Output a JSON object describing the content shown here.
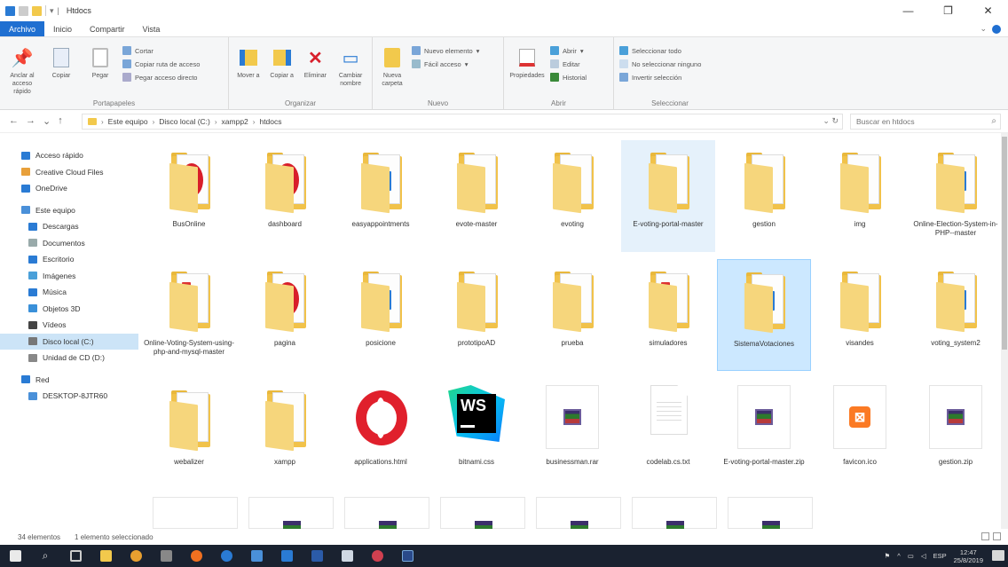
{
  "window": {
    "title": "Htdocs",
    "minimize": "—",
    "maximize": "❐",
    "close": "✕"
  },
  "ribbon_tabs": [
    "Archivo",
    "Inicio",
    "Compartir",
    "Vista"
  ],
  "ribbon": {
    "portapapeles": {
      "label": "Portapapeles",
      "anclar": "Anclar al acceso rápido",
      "copiar": "Copiar",
      "pegar": "Pegar",
      "cortar": "Cortar",
      "copiar_ruta": "Copiar ruta de acceso",
      "pegar_acceso": "Pegar acceso directo"
    },
    "organizar": {
      "label": "Organizar",
      "mover": "Mover a",
      "copiar_a": "Copiar a",
      "eliminar": "Eliminar",
      "cambiar_nombre": "Cambiar nombre"
    },
    "nuevo": {
      "label": "Nuevo",
      "nueva_carpeta": "Nueva carpeta",
      "nuevo_elemento": "Nuevo elemento",
      "facil_acceso": "Fácil acceso"
    },
    "abrir": {
      "label": "Abrir",
      "propiedades": "Propiedades",
      "abrir": "Abrir",
      "editar": "Editar",
      "historial": "Historial"
    },
    "seleccionar": {
      "label": "Seleccionar",
      "todo": "Seleccionar todo",
      "ninguno": "No seleccionar ninguno",
      "invertir": "Invertir selección"
    }
  },
  "address": {
    "crumbs": [
      "Este equipo",
      "Disco local (C:)",
      "xampp2",
      "htdocs"
    ],
    "search_placeholder": "Buscar en htdocs"
  },
  "nav": [
    {
      "label": "Acceso rápido",
      "level": 1,
      "color": "#2a7bd4"
    },
    {
      "label": "Creative Cloud Files",
      "level": 1,
      "color": "#e8a03a"
    },
    {
      "label": "OneDrive",
      "level": 1,
      "color": "#2a7bd4"
    },
    {
      "label": "Este equipo",
      "level": 1,
      "color": "#4a90d9"
    },
    {
      "label": "Descargas",
      "level": 2,
      "color": "#2a7bd4"
    },
    {
      "label": "Documentos",
      "level": 2,
      "color": "#9aa"
    },
    {
      "label": "Escritorio",
      "level": 2,
      "color": "#2a7bd4"
    },
    {
      "label": "Imágenes",
      "level": 2,
      "color": "#4aa0d9"
    },
    {
      "label": "Música",
      "level": 2,
      "color": "#2a7bd4"
    },
    {
      "label": "Objetos 3D",
      "level": 2,
      "color": "#3a90d9"
    },
    {
      "label": "Vídeos",
      "level": 2,
      "color": "#444"
    },
    {
      "label": "Disco local (C:)",
      "level": 2,
      "color": "#777",
      "selected": true
    },
    {
      "label": "Unidad de CD (D:)",
      "level": 2,
      "color": "#888"
    },
    {
      "label": "Red",
      "level": 1,
      "color": "#2a7bd4"
    },
    {
      "label": "DESKTOP-8JTR60",
      "level": 2,
      "color": "#4a90d9"
    }
  ],
  "items": [
    {
      "label": "BusOnline",
      "icon": "folder-opera"
    },
    {
      "label": "dashboard",
      "icon": "folder-opera"
    },
    {
      "label": "easyappointments",
      "icon": "folder-vscode"
    },
    {
      "label": "evote-master",
      "icon": "folder-paper"
    },
    {
      "label": "evoting",
      "icon": "folder-paper"
    },
    {
      "label": "E-voting-portal-master",
      "icon": "folder-vsbar",
      "state": "hover"
    },
    {
      "label": "gestion",
      "icon": "folder-vsbar"
    },
    {
      "label": "img",
      "icon": "folder-paper"
    },
    {
      "label": "Online-Election-System-in-PHP--master",
      "icon": "folder-vscode"
    },
    {
      "label": "Online-Voting-System-using-php-and-mysql-master",
      "icon": "folder-pdf"
    },
    {
      "label": "pagina",
      "icon": "folder-opera"
    },
    {
      "label": "posicione",
      "icon": "folder-vscode"
    },
    {
      "label": "prototipoAD",
      "icon": "folder-paper"
    },
    {
      "label": "prueba",
      "icon": "folder-paper"
    },
    {
      "label": "simuladores",
      "icon": "folder-pdf"
    },
    {
      "label": "SistemaVotaciones",
      "icon": "folder-vscode",
      "state": "selected"
    },
    {
      "label": "visandes",
      "icon": "folder-vsbar"
    },
    {
      "label": "voting_system2",
      "icon": "folder-vscode"
    },
    {
      "label": "webalizer",
      "icon": "folder-paper"
    },
    {
      "label": "xampp",
      "icon": "folder-paper"
    },
    {
      "label": "applications.html",
      "icon": "opera-file"
    },
    {
      "label": "bitnami.css",
      "icon": "webstorm-file"
    },
    {
      "label": "businessman.rar",
      "icon": "rar-file"
    },
    {
      "label": "codelab.cs.txt",
      "icon": "text-file"
    },
    {
      "label": "E-voting-portal-master.zip",
      "icon": "rar-file"
    },
    {
      "label": "favicon.ico",
      "icon": "xampp-file"
    },
    {
      "label": "gestion.zip",
      "icon": "rar-file"
    }
  ],
  "status": {
    "count": "34 elementos",
    "selected": "1 elemento seleccionado"
  },
  "taskbar": {
    "time": "12:47",
    "date": "25/8/2019",
    "lang": "ESP"
  }
}
